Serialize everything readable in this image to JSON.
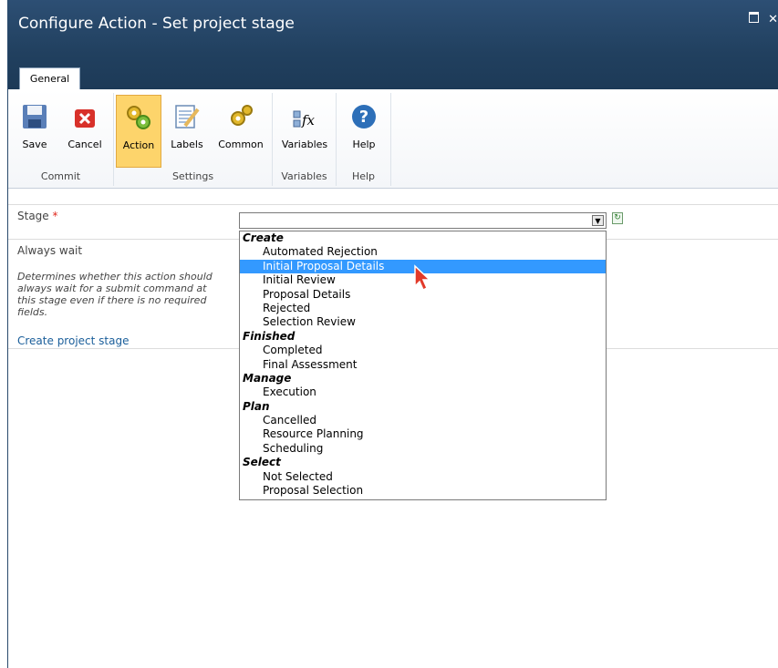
{
  "window": {
    "title": "Configure Action - Set project stage"
  },
  "tabs": [
    {
      "label": "General"
    }
  ],
  "ribbon": {
    "groups": [
      {
        "label": "Commit",
        "buttons": [
          {
            "label": "Save",
            "icon": "floppy-disk-icon"
          },
          {
            "label": "Cancel",
            "icon": "red-x-icon"
          }
        ]
      },
      {
        "label": "Settings",
        "buttons": [
          {
            "label": "Action",
            "icon": "gears-icon",
            "active": true
          },
          {
            "label": "Labels",
            "icon": "notepad-icon"
          },
          {
            "label": "Common",
            "icon": "gear-icon"
          }
        ]
      },
      {
        "label": "Variables",
        "buttons": [
          {
            "label": "Variables",
            "icon": "fx-icon"
          }
        ]
      },
      {
        "label": "Help",
        "buttons": [
          {
            "label": "Help",
            "icon": "question-icon"
          }
        ]
      }
    ]
  },
  "form": {
    "stage_label": "Stage",
    "required_mark": "*",
    "always_wait_label": "Always wait",
    "always_wait_description": "Determines whether this action should always wait for a submit command at this stage even if there is no required fields.",
    "create_link": "Create project stage",
    "stage_value": ""
  },
  "dropdown": {
    "groups": [
      {
        "name": "Create",
        "items": [
          "Automated Rejection",
          "Initial Proposal Details",
          "Initial Review",
          "Proposal Details",
          "Rejected",
          "Selection Review"
        ]
      },
      {
        "name": "Finished",
        "items": [
          "Completed",
          "Final Assessment"
        ]
      },
      {
        "name": "Manage",
        "items": [
          "Execution"
        ]
      },
      {
        "name": "Plan",
        "items": [
          "Cancelled",
          "Resource Planning",
          "Scheduling"
        ]
      },
      {
        "name": "Select",
        "items": [
          "Not Selected",
          "Proposal Selection"
        ]
      }
    ],
    "highlighted": "Initial Proposal Details"
  },
  "colors": {
    "title_bar": "#21405f",
    "active_button": "#fdd46b",
    "selection": "#3399ff",
    "link": "#1a5e9a",
    "required": "#e0261b"
  }
}
